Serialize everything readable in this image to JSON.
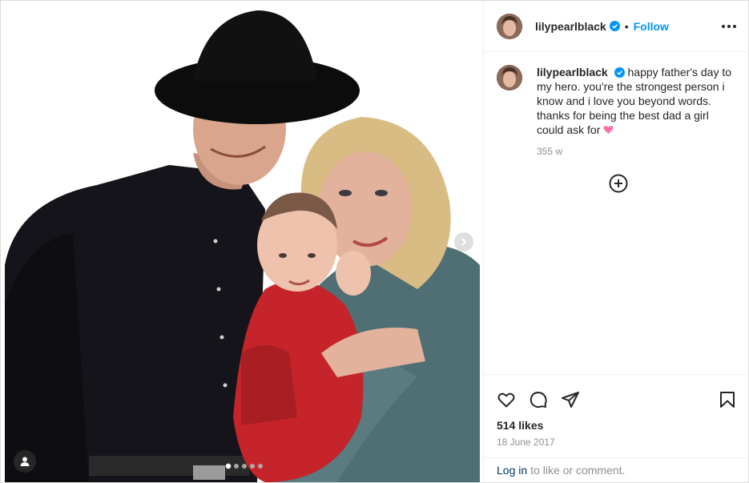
{
  "post": {
    "username": "lilypearlblack",
    "follow_label": "Follow",
    "separator": "•",
    "caption": "happy father's day to my hero. you're the strongest person i know and i love you beyond words. thanks for being the best dad a girl could ask for",
    "caption_emoji": "pink-heart",
    "time_ago": "355 w",
    "likes": "514 likes",
    "date": "18 June 2017",
    "login_link": "Log in",
    "login_text": "to like or comment."
  },
  "carousel": {
    "slides": 5,
    "active": 1
  },
  "icons": [
    "verified-badge-icon",
    "more-options-icon",
    "load-more-comments-icon",
    "like-heart-icon",
    "comment-icon",
    "share-icon",
    "save-bookmark-icon",
    "next-arrow-icon",
    "tagged-user-icon"
  ],
  "colors": {
    "accent": "#0095f6",
    "text": "#262626",
    "muted": "#8e8e8e",
    "link": "#00376b",
    "border": "#efefef"
  }
}
